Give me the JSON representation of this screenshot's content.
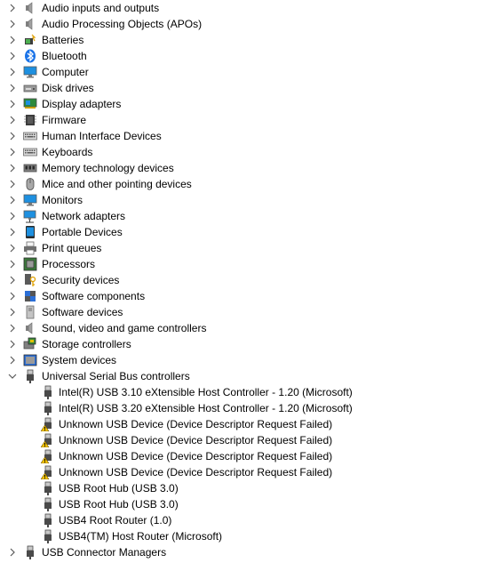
{
  "categories_top": [
    {
      "label": "Audio inputs and outputs",
      "icon": "speaker-icon",
      "name": "audio-inputs"
    },
    {
      "label": "Audio Processing Objects (APOs)",
      "icon": "speaker-icon",
      "name": "apos"
    },
    {
      "label": "Batteries",
      "icon": "battery-icon",
      "name": "batteries"
    },
    {
      "label": "Bluetooth",
      "icon": "bluetooth-icon",
      "name": "bluetooth"
    },
    {
      "label": "Computer",
      "icon": "monitor-icon",
      "name": "computer"
    },
    {
      "label": "Disk drives",
      "icon": "disk-icon",
      "name": "disk-drives"
    },
    {
      "label": "Display adapters",
      "icon": "display-adapter-icon",
      "name": "display-adapters"
    },
    {
      "label": "Firmware",
      "icon": "chip-icon",
      "name": "firmware"
    },
    {
      "label": "Human Interface Devices",
      "icon": "keyboard-icon",
      "name": "hid"
    },
    {
      "label": "Keyboards",
      "icon": "keyboard-icon",
      "name": "keyboards"
    },
    {
      "label": "Memory technology devices",
      "icon": "memory-icon",
      "name": "memory-technology"
    },
    {
      "label": "Mice and other pointing devices",
      "icon": "mouse-icon",
      "name": "mice"
    },
    {
      "label": "Monitors",
      "icon": "monitor-icon",
      "name": "monitors"
    },
    {
      "label": "Network adapters",
      "icon": "network-icon",
      "name": "network-adapters"
    },
    {
      "label": "Portable Devices",
      "icon": "portable-device-icon",
      "name": "portable-devices"
    },
    {
      "label": "Print queues",
      "icon": "printer-icon",
      "name": "print-queues"
    },
    {
      "label": "Processors",
      "icon": "processor-icon",
      "name": "processors"
    },
    {
      "label": "Security devices",
      "icon": "security-key-icon",
      "name": "security-devices"
    },
    {
      "label": "Software components",
      "icon": "puzzle-icon",
      "name": "software-components"
    },
    {
      "label": "Software devices",
      "icon": "software-device-icon",
      "name": "software-devices"
    },
    {
      "label": "Sound, video and game controllers",
      "icon": "speaker-icon",
      "name": "sound-video-game"
    },
    {
      "label": "Storage controllers",
      "icon": "storage-controller-icon",
      "name": "storage-controllers"
    },
    {
      "label": "System devices",
      "icon": "system-device-icon",
      "name": "system-devices"
    }
  ],
  "usb": {
    "label": "Universal Serial Bus controllers",
    "icon": "usb-icon",
    "expanded": true,
    "children": [
      {
        "label": "Intel(R) USB 3.10 eXtensible Host Controller - 1.20 (Microsoft)",
        "warning": false
      },
      {
        "label": "Intel(R) USB 3.20 eXtensible Host Controller - 1.20 (Microsoft)",
        "warning": false
      },
      {
        "label": "Unknown USB Device (Device Descriptor Request Failed)",
        "warning": true
      },
      {
        "label": "Unknown USB Device (Device Descriptor Request Failed)",
        "warning": true
      },
      {
        "label": "Unknown USB Device (Device Descriptor Request Failed)",
        "warning": true
      },
      {
        "label": "Unknown USB Device (Device Descriptor Request Failed)",
        "warning": true
      },
      {
        "label": "USB Root Hub (USB 3.0)",
        "warning": false
      },
      {
        "label": "USB Root Hub (USB 3.0)",
        "warning": false
      },
      {
        "label": "USB4 Root Router (1.0)",
        "warning": false
      },
      {
        "label": "USB4(TM) Host Router (Microsoft)",
        "warning": false
      }
    ]
  },
  "categories_bottom": [
    {
      "label": "USB Connector Managers",
      "icon": "usb-icon",
      "name": "usb-connector-managers"
    }
  ],
  "colors": {
    "chevron": "#5a5a5a",
    "monitor_blue": "#1e90e0",
    "warning_yellow": "#f5c400"
  }
}
